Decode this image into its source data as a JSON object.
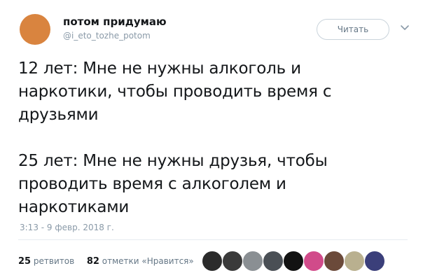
{
  "tweet": {
    "author_name": "потом придумаю",
    "author_handle": "@i_eto_tozhe_potom",
    "follow_label": "Читать",
    "paragraphs": [
      [
        "12 лет: Мне не нужны алкоголь и",
        "наркотики, чтобы проводить время с",
        "друзьями"
      ],
      [
        "25 лет: Мне не нужны друзья, чтобы",
        "проводить время с алкоголем и",
        "наркотиками"
      ]
    ],
    "timestamp": "3:13 - 9 февр. 2018 г.",
    "retweets_count": "25",
    "retweets_label": "ретвитов",
    "likes_count": "82",
    "likes_label": "отметки «Нравится»"
  },
  "colors": {
    "avatar": "#d9843f",
    "likers": [
      "#2b2b2b",
      "#3a3a3a",
      "#8a8f93",
      "#4a4f55",
      "#121212",
      "#d14b8a",
      "#6b4a3a",
      "#b9b08f",
      "#3b3f7a"
    ]
  },
  "icons": {
    "menu": "chevron-down-icon"
  }
}
